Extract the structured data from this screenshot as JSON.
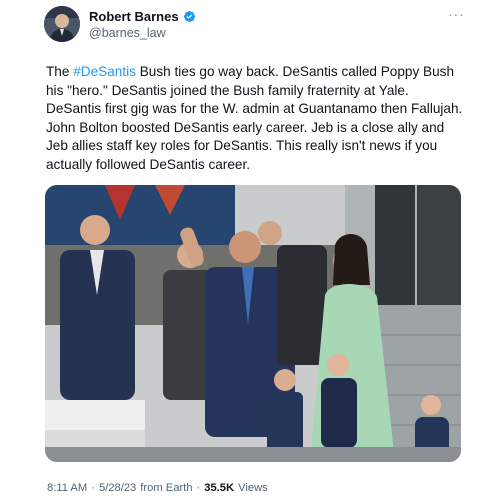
{
  "author": {
    "display_name": "Robert Barnes",
    "handle": "@barnes_law",
    "verified": true
  },
  "tweet": {
    "hashtag": "#DeSantis",
    "text_before": "The ",
    "text_after": " Bush ties go way back. DeSantis called Poppy Bush his \"hero.\" DeSantis joined the Bush family fraternity at Yale. DeSantis first gig was for the W. admin at Guantanamo then Fallujah. John Bolton boosted DeSantis early career. Jeb is a close ally and Jeb allies staff key roles for DeSantis. This really isn't news if you actually followed DeSantis career."
  },
  "meta": {
    "time": "8:11 AM",
    "date": "5/28/23",
    "source": "from Earth",
    "views_count": "35.5K",
    "views_label": "Views",
    "separator": "·"
  },
  "colors": {
    "accent": "#1d9bf0",
    "secondary_text": "#536471"
  },
  "icons": {
    "verified": "verified-badge-icon",
    "more": "more-options-icon"
  }
}
